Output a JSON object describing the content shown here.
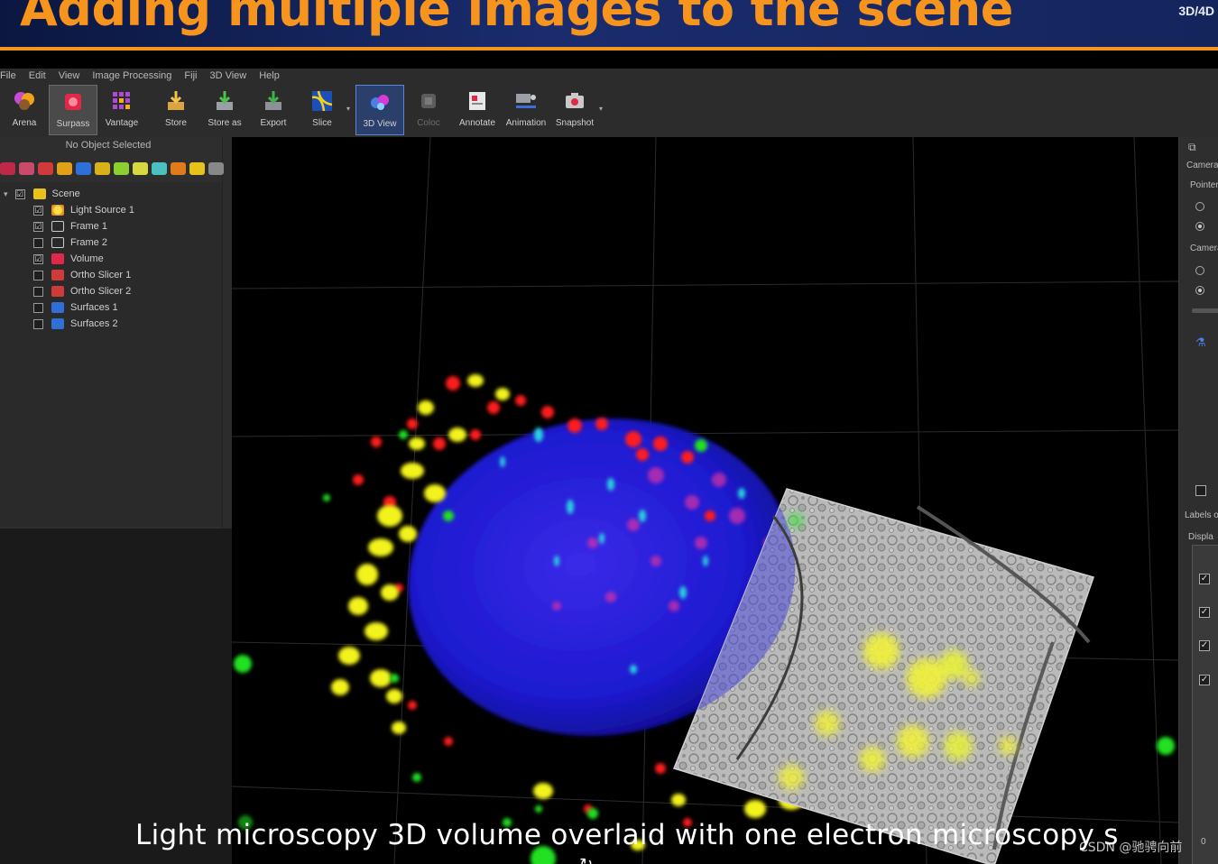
{
  "banner": {
    "title": "Adding multiple images to the scene",
    "tag": "3D/4D"
  },
  "menubar": [
    "File",
    "Edit",
    "View",
    "Image Processing",
    "Fiji",
    "3D View",
    "Help"
  ],
  "toolbar": [
    {
      "label": "Arena",
      "icon": "arena-icon",
      "state": "normal"
    },
    {
      "label": "Surpass",
      "icon": "surpass-icon",
      "state": "active"
    },
    {
      "label": "Vantage",
      "icon": "vantage-icon",
      "state": "normal"
    },
    {
      "label": "Store",
      "icon": "store-icon",
      "state": "normal"
    },
    {
      "label": "Store as",
      "icon": "store-as-icon",
      "state": "normal"
    },
    {
      "label": "Export",
      "icon": "export-icon",
      "state": "normal"
    },
    {
      "label": "Slice",
      "icon": "slice-icon",
      "state": "normal"
    },
    {
      "label": "3D View",
      "icon": "3d-view-icon",
      "state": "selected"
    },
    {
      "label": "Coloc",
      "icon": "coloc-icon",
      "state": "disabled"
    },
    {
      "label": "Annotate",
      "icon": "annotate-icon",
      "state": "normal"
    },
    {
      "label": "Animation",
      "icon": "animation-icon",
      "state": "normal"
    },
    {
      "label": "Snapshot",
      "icon": "snapshot-icon",
      "state": "normal"
    }
  ],
  "left_panel": {
    "status": "No Object Selected",
    "tree": [
      {
        "label": "Scene",
        "checked": true,
        "icon": "folder-icon",
        "level": 0
      },
      {
        "label": "Light Source 1",
        "checked": true,
        "icon": "light-source-icon",
        "level": 1
      },
      {
        "label": "Frame 1",
        "checked": true,
        "icon": "frame-icon",
        "level": 1
      },
      {
        "label": "Frame 2",
        "checked": false,
        "icon": "frame-icon",
        "level": 1
      },
      {
        "label": "Volume",
        "checked": true,
        "icon": "volume-icon",
        "level": 1
      },
      {
        "label": "Ortho Slicer 1",
        "checked": false,
        "icon": "ortho-slicer-icon",
        "level": 1
      },
      {
        "label": "Ortho Slicer 2",
        "checked": false,
        "icon": "ortho-slicer-icon",
        "level": 1
      },
      {
        "label": "Surfaces 1",
        "checked": false,
        "icon": "surfaces-icon",
        "level": 1
      },
      {
        "label": "Surfaces 2",
        "checked": false,
        "icon": "surfaces-icon",
        "level": 1
      }
    ]
  },
  "right_panel": {
    "camera_label": "Camera",
    "pointer_label": "Pointer",
    "camera_type_label": "Camera",
    "labels_label": "Labels o",
    "display_label": "Displa",
    "value": "0"
  },
  "caption": "Light microscopy 3D volume overlaid with one electron microscopy s",
  "watermark": "CSDN @驰骋向前",
  "colors": {
    "title": "#f7941d",
    "nucleus": "#1e1ed8",
    "red_marker": "#ff1a1a",
    "yellow_marker": "#f2f21a",
    "green_marker": "#22e022"
  }
}
